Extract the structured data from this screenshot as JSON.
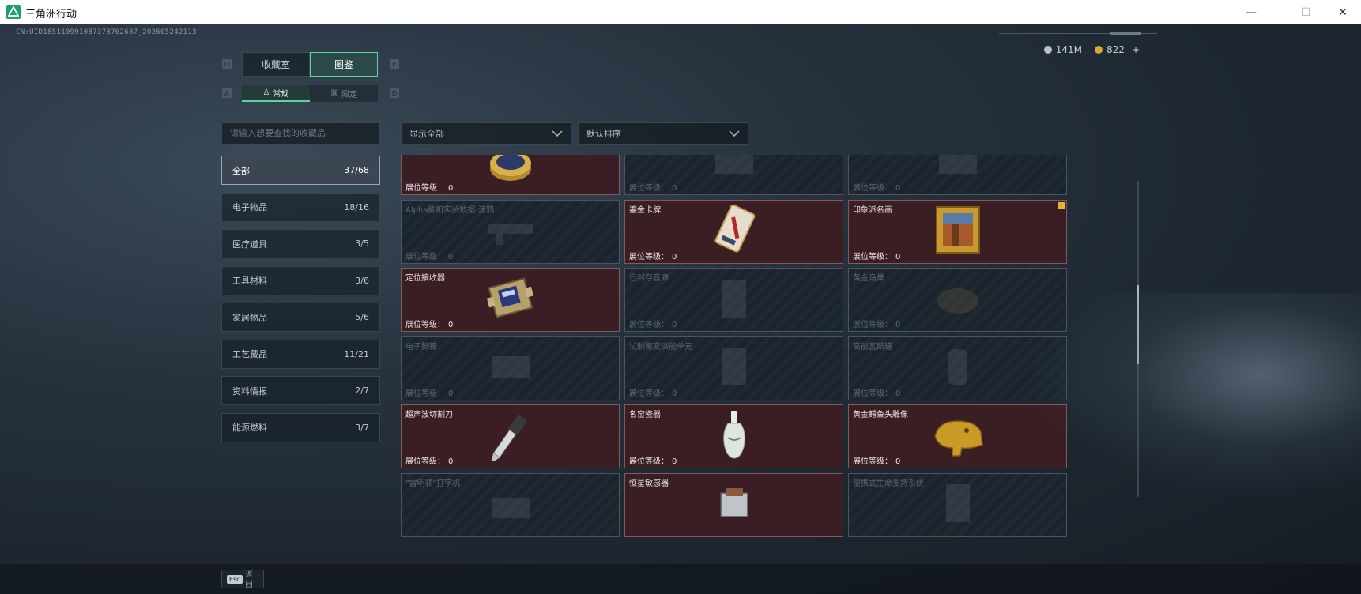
{
  "window": {
    "title": "三角洲行动",
    "minimize_glyph": "—",
    "maximize_glyph": "☐",
    "close_glyph": "✕"
  },
  "uid": "CN:UID185110991087378762687_202605242113",
  "currency": {
    "silver": "141M",
    "gold": "822",
    "plus": "+"
  },
  "tabs": [
    {
      "label": "收藏室",
      "key": "Q"
    },
    {
      "label": "图鉴",
      "key": "E",
      "active": true
    }
  ],
  "subtabs": [
    {
      "label": "常规",
      "key": "A",
      "active": true
    },
    {
      "label": "限定",
      "key": "D"
    }
  ],
  "search": {
    "placeholder": "请输入想要查找的收藏品"
  },
  "filters": {
    "display": "显示全部",
    "sort": "默认排序"
  },
  "categories": [
    {
      "label": "全部",
      "count": "37/68",
      "active": true
    },
    {
      "label": "电子物品",
      "count": "18/16"
    },
    {
      "label": "医疗道具",
      "count": "3/5"
    },
    {
      "label": "工具材料",
      "count": "3/6"
    },
    {
      "label": "家居物品",
      "count": "5/6"
    },
    {
      "label": "工艺藏品",
      "count": "11/21"
    },
    {
      "label": "资料情报",
      "count": "2/7"
    },
    {
      "label": "能源燃料",
      "count": "3/7"
    }
  ],
  "level_label": "展位等级：",
  "items": [
    {
      "name": "",
      "level": "0",
      "owned": true,
      "icon": "compass-icon"
    },
    {
      "name": "",
      "level": "0",
      "owned": false,
      "icon": "device-icon"
    },
    {
      "name": "",
      "level": "0",
      "owned": false,
      "icon": "device-icon"
    },
    {
      "name": "Alpha脑机实验数据-渡鸦",
      "level": "0",
      "owned": false,
      "icon": "gun-icon"
    },
    {
      "name": "鎏金卡牌",
      "level": "0",
      "owned": true,
      "icon": "card-icon"
    },
    {
      "name": "印象派名画",
      "level": "0",
      "owned": true,
      "icon": "painting-icon",
      "badge": "!"
    },
    {
      "name": "定位接收器",
      "level": "0",
      "owned": true,
      "icon": "receiver-icon"
    },
    {
      "name": "已封存音源",
      "level": "0",
      "owned": false,
      "icon": "box-icon"
    },
    {
      "name": "黄金鸟巢",
      "level": "0",
      "owned": false,
      "icon": "nest-icon"
    },
    {
      "name": "电子脚镣",
      "level": "0",
      "owned": false,
      "icon": "device-icon"
    },
    {
      "name": "试制聚变供能单元",
      "level": "0",
      "owned": false,
      "icon": "box-icon"
    },
    {
      "name": "高能瓦斯罐",
      "level": "0",
      "owned": false,
      "icon": "tank-icon"
    },
    {
      "name": "超声波切割刀",
      "level": "0",
      "owned": true,
      "icon": "knife-icon"
    },
    {
      "name": "名窑瓷器",
      "level": "0",
      "owned": true,
      "icon": "vase-icon"
    },
    {
      "name": "黄金鳄鱼头雕像",
      "level": "0",
      "owned": true,
      "icon": "croc-icon"
    },
    {
      "name": "\"雷明顿\"打字机",
      "level": "",
      "owned": false,
      "icon": "typewriter-icon"
    },
    {
      "name": "恒星敏感器",
      "level": "",
      "owned": true,
      "icon": "sensor-icon"
    },
    {
      "name": "便携式生命支持系统",
      "level": "",
      "owned": false,
      "icon": "box-icon"
    }
  ],
  "esc": {
    "key": "Esc",
    "label": "返回"
  },
  "colors": {
    "accent": "#5fd3a4",
    "owned_bg": "#3a1e24",
    "locked_bg": "#1b242c"
  }
}
